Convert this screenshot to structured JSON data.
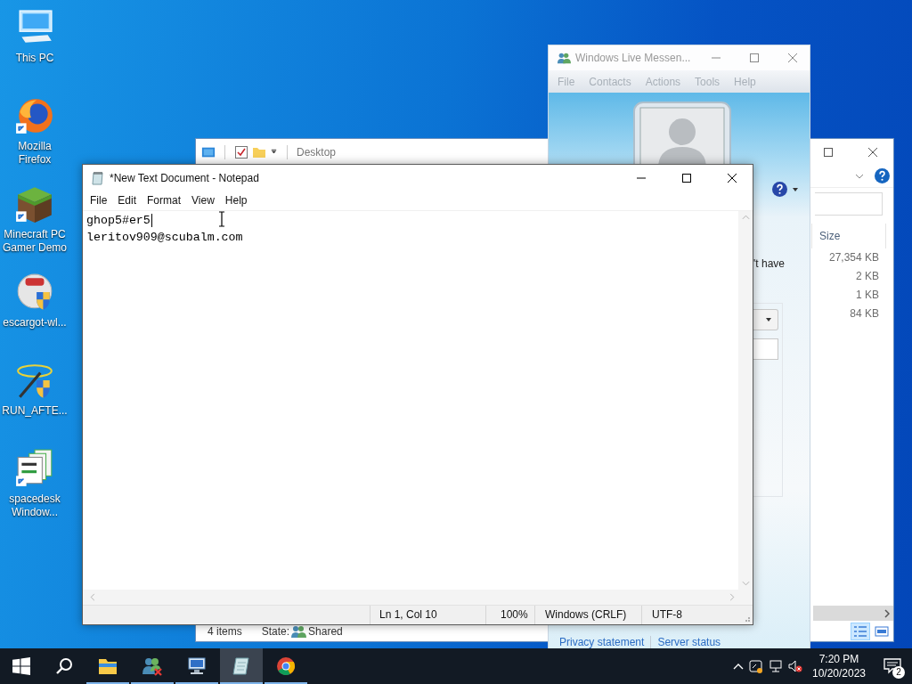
{
  "desktop_icons": [
    {
      "label": "This PC",
      "kind": "pc",
      "shortcut": false
    },
    {
      "label": "Mozilla Firefox",
      "kind": "firefox",
      "shortcut": true
    },
    {
      "label": "Minecraft PC Gamer Demo",
      "kind": "minecraft",
      "shortcut": true
    },
    {
      "label": "escargot-wl...",
      "kind": "escargot",
      "shortcut": false
    },
    {
      "label": "RUN_AFTE...",
      "kind": "wand",
      "shortcut": false
    },
    {
      "label": "spacedesk Window...",
      "kind": "spacedesk",
      "shortcut": true
    }
  ],
  "explorer": {
    "title": "Desktop",
    "column": "Size",
    "sizes": [
      "27,354 KB",
      "2 KB",
      "1 KB",
      "84 KB"
    ],
    "item_count": "4 items",
    "state_label": "State:",
    "state": "Shared"
  },
  "messenger": {
    "title": "Windows Live Messen...",
    "menu": [
      "File",
      "Contacts",
      "Actions",
      "Tools",
      "Help"
    ],
    "partial_text": "'t have",
    "links": [
      "Privacy statement",
      "Server status"
    ]
  },
  "notepad": {
    "title": "*New Text Document - Notepad",
    "menu": [
      "File",
      "Edit",
      "Format",
      "View",
      "Help"
    ],
    "lines": [
      "ghop5#er5",
      "leritov909@scubalm.com"
    ],
    "status": [
      "Ln 1, Col 10",
      "100%",
      "Windows (CRLF)",
      "UTF-8"
    ]
  },
  "taskbar": {
    "apps": [
      {
        "kind": "folder",
        "selected": false
      },
      {
        "kind": "people",
        "selected": false
      },
      {
        "kind": "computer",
        "selected": false
      },
      {
        "kind": "notepad",
        "selected": true
      },
      {
        "kind": "browser",
        "selected": false
      }
    ],
    "time": "7:20 PM",
    "date": "10/20/2023",
    "notifications": "2"
  }
}
